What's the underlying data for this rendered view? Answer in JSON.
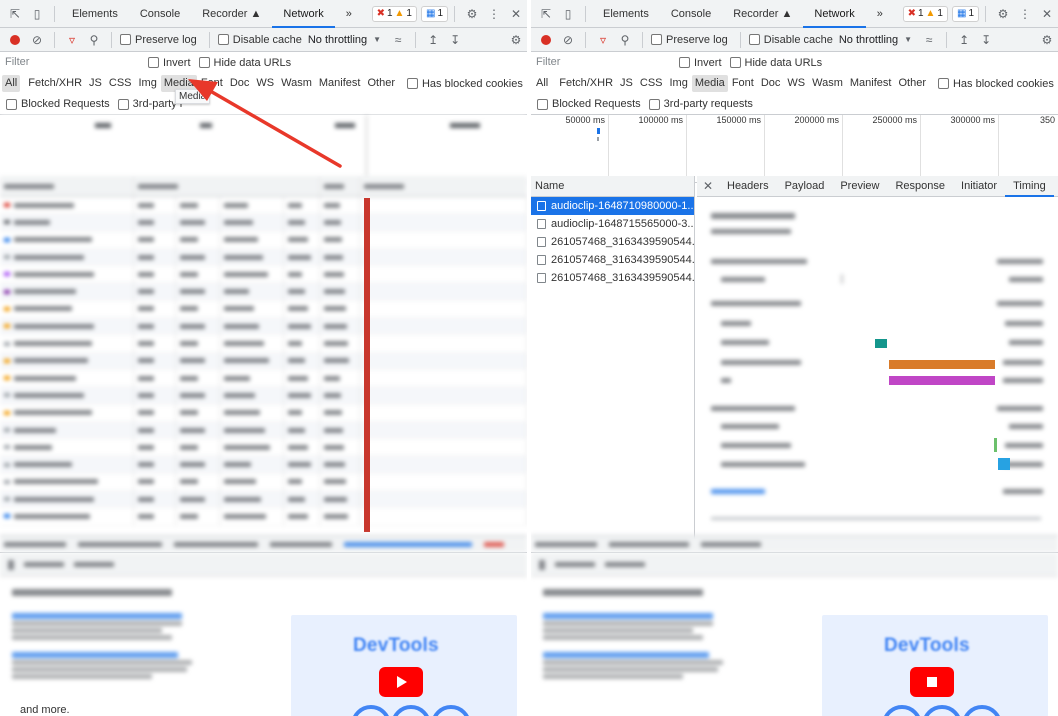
{
  "devtools": {
    "tabs": [
      "Elements",
      "Console",
      "Recorder",
      "Network"
    ],
    "active_tab": "Network",
    "more_tabs": "»",
    "counts": {
      "errors": "1",
      "warnings": "1",
      "messages": "1"
    }
  },
  "toolbar": {
    "preserve_log": "Preserve log",
    "disable_cache": "Disable cache",
    "throttling": "No throttling"
  },
  "filter": {
    "placeholder": "Filter",
    "invert": "Invert",
    "hide_data_urls": "Hide data URLs"
  },
  "types": [
    "All",
    "Fetch/XHR",
    "JS",
    "CSS",
    "Img",
    "Media",
    "Font",
    "Doc",
    "WS",
    "Wasm",
    "Manifest",
    "Other"
  ],
  "has_blocked_cookies": "Has blocked cookies",
  "blocked_requests": "Blocked Requests",
  "third_party": "3rd-party requests",
  "third_party_truncated": "3rd-party r",
  "tooltip": "Media",
  "overview_ticks": [
    "50000 ms",
    "100000 ms",
    "150000 ms",
    "200000 ms",
    "250000 ms",
    "300000 ms",
    "350"
  ],
  "request_list": {
    "header": "Name",
    "items": [
      "audioclip-1648710980000-1...",
      "audioclip-1648715565000-3...",
      "261057468_3163439590544...",
      "261057468_3163439590544...",
      "261057468_3163439590544..."
    ]
  },
  "detail_tabs": [
    "Headers",
    "Payload",
    "Preview",
    "Response",
    "Initiator",
    "Timing"
  ],
  "detail_active_tab": "Timing",
  "drawer": {
    "devtools_card_title": "DevTools",
    "and_more": "and more."
  },
  "colors": {
    "accent": "#1a73e8",
    "record": "#d93025",
    "timing_teal": "#14968c",
    "timing_orange": "#d97b29",
    "timing_purple": "#c046c6",
    "timing_green": "#6cc06c",
    "timing_blue": "#27a2e2"
  }
}
